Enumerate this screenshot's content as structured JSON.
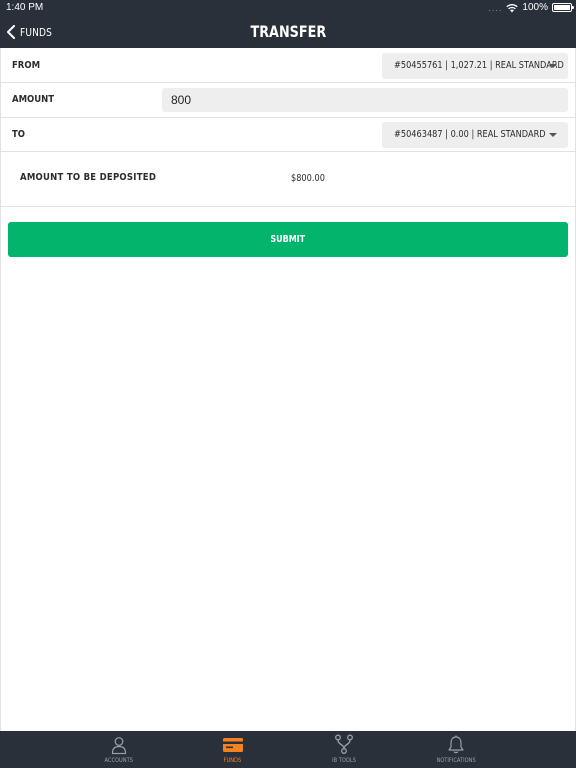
{
  "status_bar": {
    "time": "1:40 PM",
    "signal": "....",
    "battery": "100%",
    "wifi_icon": "wifi-icon",
    "battery_icon": "battery-icon"
  },
  "nav": {
    "back_label": "FUNDS",
    "back_icon": "chevron-left-icon",
    "title": "TRANSFER"
  },
  "form": {
    "from": {
      "label": "FROM",
      "value": "#50455761 | 1,027.21 | REAL STANDARD"
    },
    "amount": {
      "label": "AMOUNT",
      "value": "800"
    },
    "to": {
      "label": "TO",
      "value": "#50463487 | 0.00 | REAL STANDARD"
    },
    "deposit": {
      "label": "AMOUNT TO BE DEPOSITED",
      "value": "$800.00"
    },
    "submit_label": "SUBMIT"
  },
  "tabs": [
    {
      "label": "ACCOUNTS",
      "icon": "user-icon",
      "active": false
    },
    {
      "label": "FUNDS",
      "icon": "credit-card-icon",
      "active": true
    },
    {
      "label": "IB TOOLS",
      "icon": "network-icon",
      "active": false
    },
    {
      "label": "NOTIFICATIONS",
      "icon": "bell-icon",
      "active": false
    }
  ],
  "colors": {
    "header_bg": "#2a303a",
    "submit_green": "#03b46c",
    "active_tab": "#f58220",
    "inactive_tab": "#9aa0a8"
  }
}
